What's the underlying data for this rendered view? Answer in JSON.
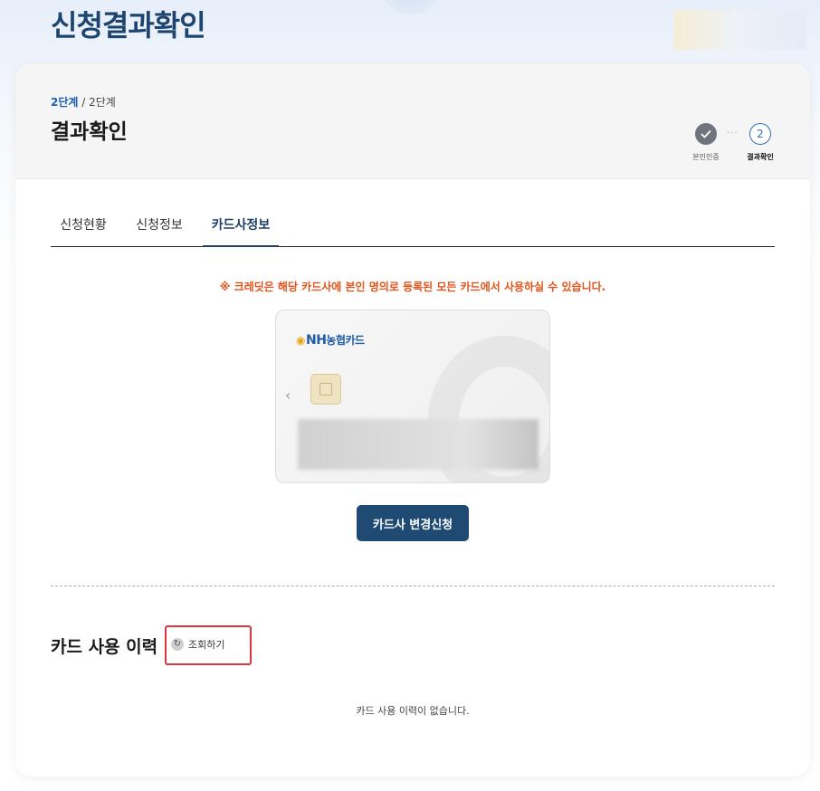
{
  "header": {
    "title": "신청결과확인"
  },
  "panel": {
    "breadcrumb": {
      "current": "2단계",
      "separator": " / ",
      "total": "2단계"
    },
    "section_title": "결과확인",
    "stepper": {
      "steps": [
        {
          "label": "본인인증",
          "status": "done",
          "icon": "check-icon"
        },
        {
          "label": "결과확인",
          "number": "2",
          "status": "current"
        }
      ],
      "connector": "···"
    }
  },
  "tabs": [
    {
      "label": "신청현황",
      "active": false
    },
    {
      "label": "신청정보",
      "active": false
    },
    {
      "label": "카드사정보",
      "active": true
    }
  ],
  "notice": "※ 크레딧은 해당 카드사에 본인 명의로 등록된 모든 카드에서 사용하실 수 있습니다.",
  "card": {
    "brand_latin": "NH",
    "brand_korean": "농협카드",
    "prev_arrow": "‹"
  },
  "change_button": "카드사 변경신청",
  "history": {
    "title": "카드 사용 이력",
    "lookup_button": "조회하기",
    "empty_message": "카드 사용 이력이 없습니다."
  },
  "colors": {
    "primary": "#1e4a73",
    "heading": "#1d4570",
    "notice": "#e2541b",
    "highlight_border": "#d9363e",
    "step_active": "#2f6fb5"
  }
}
